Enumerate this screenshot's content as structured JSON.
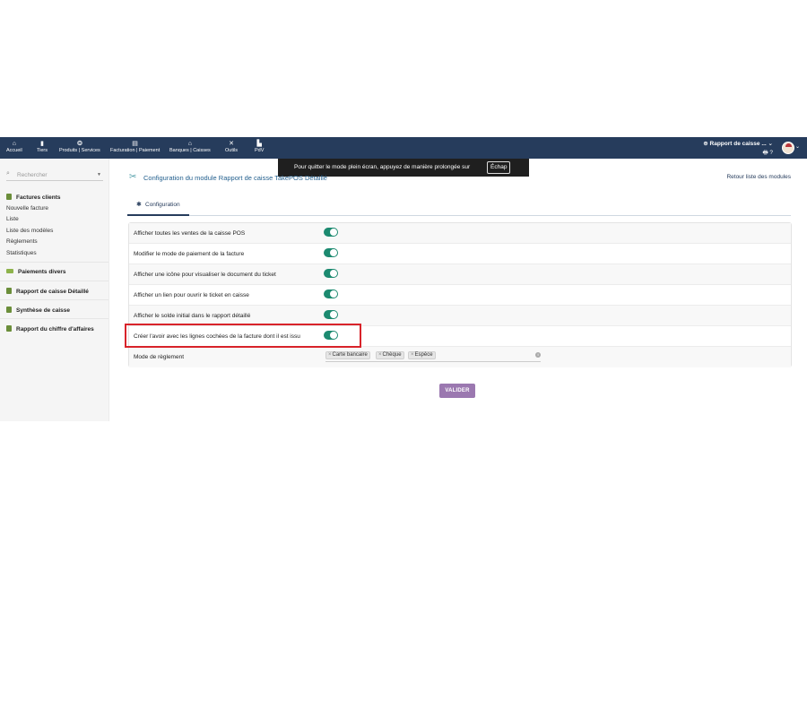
{
  "nav": {
    "items": [
      {
        "icon": "home-icon",
        "glyph": "⌂",
        "label": "Accueil"
      },
      {
        "icon": "building-icon",
        "glyph": "▮",
        "label": "Tiers"
      },
      {
        "icon": "cube-icon",
        "glyph": "❂",
        "label": "Produits | Services"
      },
      {
        "icon": "file-invoice-icon",
        "glyph": "▤",
        "label": "Facturation | Paiement"
      },
      {
        "icon": "bank-icon",
        "glyph": "⌂",
        "label": "Banques | Caisses"
      },
      {
        "icon": "wrench-icon",
        "glyph": "✕",
        "label": "Outils"
      },
      {
        "icon": "cash-register-icon",
        "glyph": "▙",
        "label": "PdV"
      }
    ],
    "module_switch": "⊕ Rapport de caisse ... ⌄",
    "tool_icons": "🖶 ?"
  },
  "fullscreen_tip": {
    "message": "Pour quitter le mode plein écran, appuyez de manière prolongée sur",
    "key": "Échap"
  },
  "sidebar": {
    "search_placeholder": "Rechercher",
    "factures_clients": "Factures clients",
    "sub": {
      "nouvelle_facture": "Nouvelle facture",
      "liste": "Liste",
      "liste_modeles": "Liste des modèles",
      "reglements": "Règlements",
      "statistiques": "Statistiques"
    },
    "paiements_divers": "Paiements divers",
    "rapport_caisse_detaille": "Rapport de caisse Détaillé",
    "synthese_caisse": "Synthèse de caisse",
    "rapport_ca": "Rapport du chiffre d'affaires"
  },
  "main": {
    "title": "Configuration du module Rapport de caisse TakePOS Détaillé",
    "back_link": "Retour liste des modules",
    "tab_label": "Configuration",
    "settings": [
      {
        "label": "Afficher toutes les ventes de la caisse POS",
        "enabled": true
      },
      {
        "label": "Modifier le mode de paiement de la facture",
        "enabled": true
      },
      {
        "label": "Afficher une icône pour visualiser le document du ticket",
        "enabled": true
      },
      {
        "label": "Afficher un lien pour ouvrir le ticket en caisse",
        "enabled": true
      },
      {
        "label": "Afficher le solde initial dans le rapport détaillé",
        "enabled": true
      },
      {
        "label": "Créer l'avoir avec les lignes cochées de la facture dont il est issu",
        "enabled": true
      }
    ],
    "payment_mode": {
      "label": "Mode de règlement",
      "chips": [
        "Carte bancaire",
        "Chèque",
        "Espèce"
      ]
    },
    "validate_label": "VALIDER"
  },
  "colors": {
    "topbar": "#263c5c",
    "toggle_on": "#1c8a70",
    "highlight": "#d8232a",
    "validate": "#9b78b0"
  }
}
